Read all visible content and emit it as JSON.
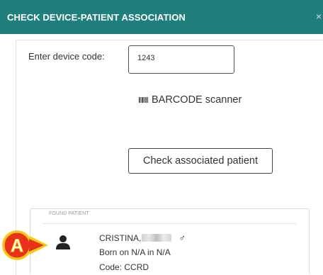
{
  "dialog": {
    "title": "CHECK DEVICE-PATIENT ASSOCIATION",
    "close_glyph": "×"
  },
  "form": {
    "device_code_label": "Enter device code:",
    "device_code_value": "1243",
    "barcode_label": "BARCODE scanner",
    "check_button_label": "Check associated patient"
  },
  "found_patient": {
    "section_title": "FOUND PATIENT",
    "name": "CRISTINA,",
    "gender_symbol": "♂",
    "born": "Born on N/A in N/A",
    "code": "Code: CCRD"
  },
  "callout": {
    "letter": "A"
  },
  "colors": {
    "header_bg": "#1f7f7d",
    "callout_fill": "#e8321c",
    "callout_ring": "#f6c814"
  },
  "icons": {
    "barcode": "barcode-icon",
    "patient": "user-icon",
    "close": "close-icon",
    "gender": "male-icon"
  }
}
